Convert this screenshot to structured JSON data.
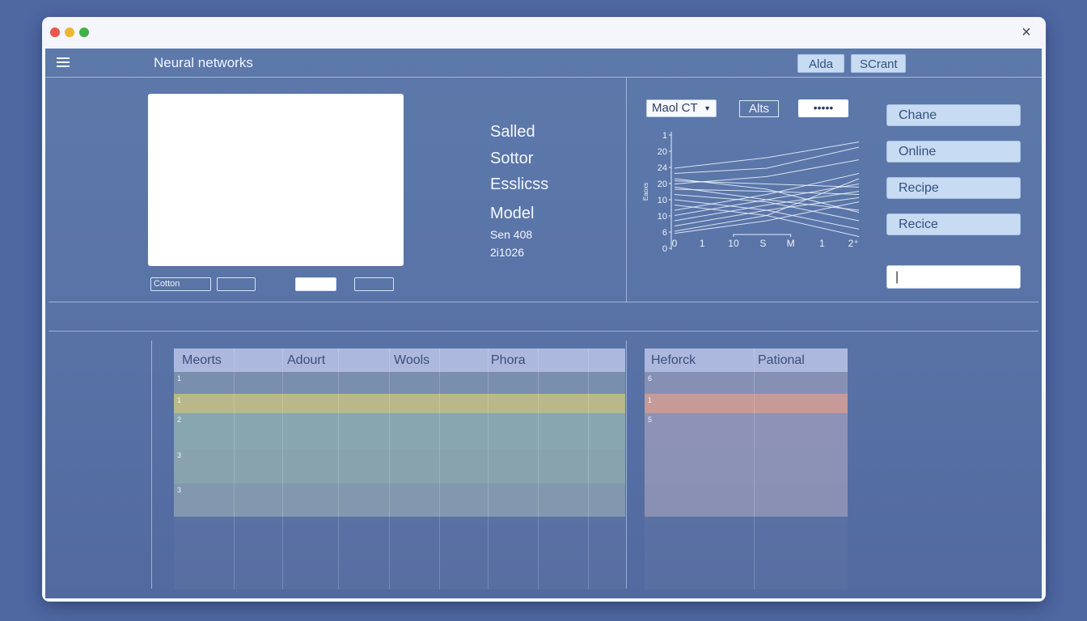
{
  "window": {
    "close_glyph": "×"
  },
  "header": {
    "title": "Neural networks",
    "buttons": [
      "Alda",
      "SCrant"
    ]
  },
  "preview": {
    "buttons": [
      {
        "label": "Cotton"
      },
      {
        "label": ""
      },
      {
        "label": ""
      },
      {
        "label": ""
      }
    ]
  },
  "info": {
    "items": [
      "Salled",
      "Sottor",
      "Esslicss",
      "Model"
    ],
    "details": [
      "Sen 408",
      "2i1026"
    ]
  },
  "chart_controls": {
    "select_label": "Maol CT",
    "button_label": "Alts",
    "dots_label": "•••••"
  },
  "chart_data": {
    "type": "line",
    "ylabel": "Eaoxs",
    "y_ticks": [
      "1",
      "20",
      "24",
      "20",
      "10",
      "10",
      "6",
      "0"
    ],
    "x_ticks": [
      "0",
      "1",
      "10",
      "S",
      "M",
      "1",
      "2⁺"
    ],
    "series": [
      {
        "values": [
          55,
          62,
          78
        ]
      },
      {
        "values": [
          65,
          70,
          90
        ]
      },
      {
        "values": [
          58,
          55,
          52
        ]
      },
      {
        "values": [
          50,
          48,
          45
        ]
      },
      {
        "values": [
          52,
          40,
          30
        ]
      },
      {
        "values": [
          45,
          38,
          20
        ]
      },
      {
        "values": [
          40,
          30,
          12
        ]
      },
      {
        "values": [
          35,
          25,
          5
        ]
      },
      {
        "values": [
          30,
          45,
          65
        ]
      },
      {
        "values": [
          25,
          40,
          55
        ]
      },
      {
        "values": [
          20,
          35,
          48
        ]
      },
      {
        "values": [
          15,
          30,
          42
        ]
      },
      {
        "values": [
          10,
          25,
          60
        ]
      },
      {
        "values": [
          8,
          20,
          38
        ]
      },
      {
        "values": [
          60,
          50,
          28
        ]
      },
      {
        "values": [
          70,
          80,
          95
        ]
      }
    ]
  },
  "sidebar": {
    "buttons": [
      "Chane",
      "Online",
      "Recipe",
      "Recice"
    ],
    "input_value": "|"
  },
  "tables": {
    "left": {
      "headers": [
        "Meorts",
        "Adourt",
        "Wools",
        "Phora"
      ],
      "row_numbers": [
        "1",
        "1",
        "2",
        "3",
        "3"
      ]
    },
    "right": {
      "headers": [
        "Heforck",
        "Pational"
      ],
      "row_numbers": [
        "6",
        "1",
        "5"
      ]
    }
  },
  "colors": {
    "highlight_left": "#b8b88a",
    "highlight_right": "#c79a98",
    "row_teal": "#88a6b0",
    "row_plain": "#7a8eae",
    "row_right": "#8e92b6"
  }
}
